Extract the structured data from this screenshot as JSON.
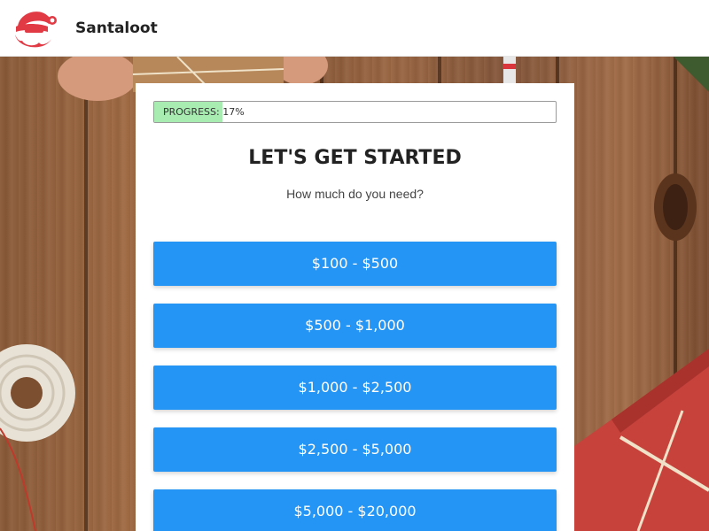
{
  "header": {
    "brand_name": "Santaloot",
    "logo_icon": "santa-logo-icon",
    "logo_color": "#e23a45"
  },
  "background": {
    "image": "wooden-table-with-christmas-gifts-and-twine"
  },
  "card": {
    "progress": {
      "label": "PROGRESS: 17%",
      "percent": 17,
      "fill_color": "#a8ecb2"
    },
    "title": "LET'S GET STARTED",
    "subtitle": "How much do you need?",
    "button_color": "#2595f5",
    "options": [
      {
        "label": "$100 - $500"
      },
      {
        "label": "$500 - $1,000"
      },
      {
        "label": "$1,000 - $2,500"
      },
      {
        "label": "$2,500 - $5,000"
      },
      {
        "label": "$5,000 - $20,000"
      }
    ]
  }
}
